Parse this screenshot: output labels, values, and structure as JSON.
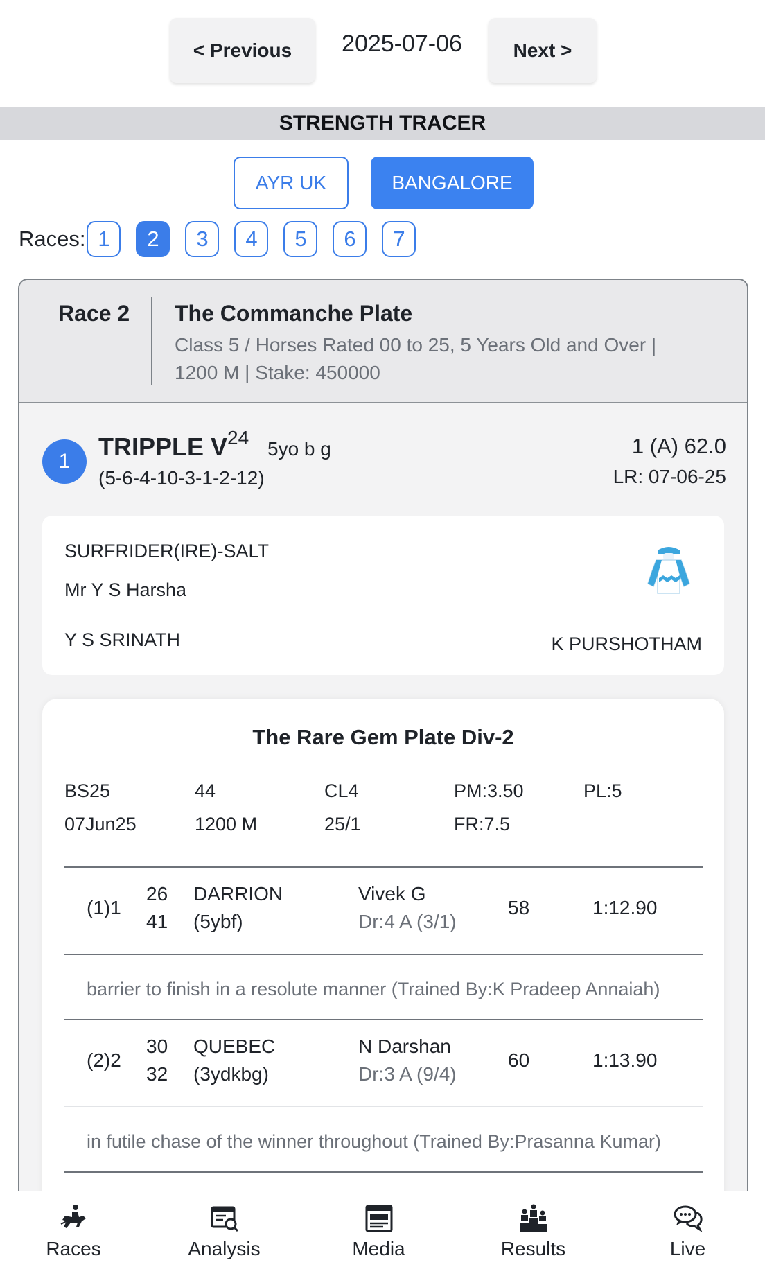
{
  "date_nav": {
    "prev_label": "< Previous",
    "date": "2025-07-06",
    "next_label": "Next >"
  },
  "section_title": "STRENGTH TRACER",
  "venues": [
    {
      "label": "AYR UK",
      "active": false
    },
    {
      "label": "BANGALORE",
      "active": true
    }
  ],
  "races": {
    "label": "Races:",
    "numbers": [
      "1",
      "2",
      "3",
      "4",
      "5",
      "6",
      "7"
    ],
    "active": "2"
  },
  "race": {
    "number_label": "Race 2",
    "title": "The Commanche Plate",
    "desc_line1": "Class 5 / Horses Rated 00 to 25, 5 Years Old and Over |",
    "desc_line2": "1200 M | Stake: 450000"
  },
  "horse": {
    "number": "1",
    "name": "TRIPPLE V",
    "sup": "24",
    "age": "5yo b g",
    "form": "(5-6-4-10-3-1-2-12)",
    "rating": "1 (A) 62.0",
    "last_run": "LR: 07-06-25",
    "pedigree": "SURFRIDER(IRE)-SALT",
    "owner": "Mr Y S Harsha",
    "trainer": "Y S SRINATH",
    "jockey": "K PURSHOTHAM",
    "silks_color": "#3ba6de"
  },
  "previous_race": {
    "title": "The Rare Gem Plate Div-2",
    "meta_row1": [
      "BS25",
      "44",
      "CL4",
      "PM:3.50",
      "PL:5"
    ],
    "meta_row2": [
      "07Jun25",
      "1200 M",
      "25/1",
      "FR:7.5"
    ],
    "results": [
      {
        "pos": "(1)1",
        "num_top": "26",
        "num_bottom": "41",
        "horse": "DARRION",
        "horse_info": "(5ybf)",
        "jockey": "Vivek G",
        "draw": "Dr:4 A (3/1)",
        "weight": "58",
        "time": "1:12.90",
        "comment": "barrier to finish in a resolute manner (Trained By:K Pradeep Annaiah)"
      },
      {
        "pos": "(2)2",
        "num_top": "30",
        "num_bottom": "32",
        "horse": "QUEBEC",
        "horse_info": "(3ydkbg)",
        "jockey": "N Darshan",
        "draw": "Dr:3 A (9/4)",
        "weight": "60",
        "time": "1:13.90",
        "comment": "in futile chase of the winner throughout (Trained By:Prasanna Kumar)"
      }
    ]
  },
  "bottom_nav": [
    {
      "label": "Races",
      "icon": "horse-racing-icon"
    },
    {
      "label": "Analysis",
      "icon": "analysis-icon"
    },
    {
      "label": "Media",
      "icon": "media-icon"
    },
    {
      "label": "Results",
      "icon": "podium-icon"
    },
    {
      "label": "Live",
      "icon": "chat-icon"
    }
  ]
}
